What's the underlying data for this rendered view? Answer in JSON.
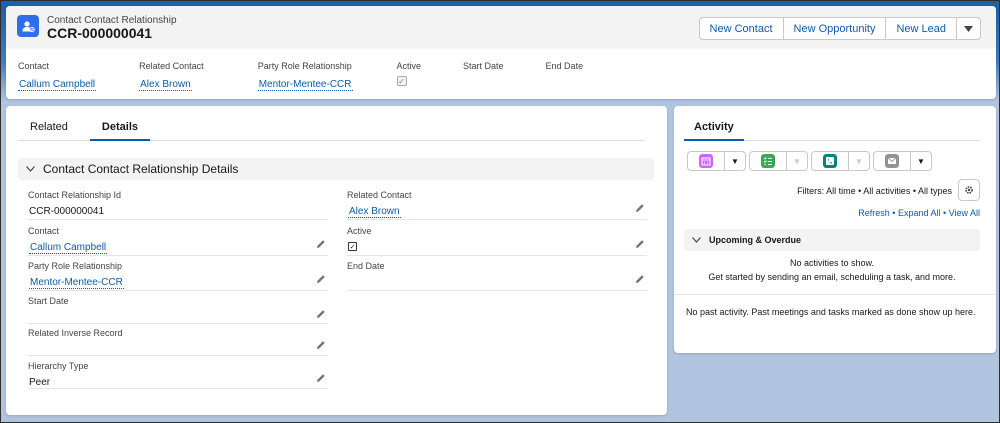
{
  "header": {
    "object_type": "Contact Contact Relationship",
    "record_name": "CCR-000000041",
    "buttons": [
      "New Contact",
      "New Opportunity",
      "New Lead"
    ],
    "highlights": [
      {
        "label": "Contact",
        "value": "Callum Campbell",
        "kind": "link"
      },
      {
        "label": "Related Contact",
        "value": "Alex Brown",
        "kind": "link"
      },
      {
        "label": "Party Role Relationship",
        "value": "Mentor-Mentee-CCR",
        "kind": "link"
      },
      {
        "label": "Active",
        "value": "checked",
        "kind": "checkbox"
      },
      {
        "label": "Start Date",
        "value": "",
        "kind": "text"
      },
      {
        "label": "End Date",
        "value": "",
        "kind": "text"
      }
    ]
  },
  "main": {
    "tabs": [
      "Related",
      "Details"
    ],
    "active_tab": "Details",
    "section_title": "Contact Contact Relationship Details",
    "left_fields": [
      {
        "label": "Contact Relationship Id",
        "value": "CCR-000000041",
        "kind": "text",
        "editable": false
      },
      {
        "label": "Contact",
        "value": "Callum Campbell",
        "kind": "link",
        "editable": true
      },
      {
        "label": "Party Role Relationship",
        "value": "Mentor-Mentee-CCR",
        "kind": "link",
        "editable": true
      },
      {
        "label": "Start Date",
        "value": "",
        "kind": "text",
        "editable": true
      },
      {
        "label": "Related Inverse Record",
        "value": "",
        "kind": "text",
        "editable": true
      },
      {
        "label": "Hierarchy Type",
        "value": "Peer",
        "kind": "text",
        "editable": true
      }
    ],
    "right_fields": [
      {
        "label": "Related Contact",
        "value": "Alex Brown",
        "kind": "link",
        "editable": true
      },
      {
        "label": "Active",
        "value": "checked",
        "kind": "checkbox",
        "editable": true
      },
      {
        "label": "End Date",
        "value": "",
        "kind": "text",
        "editable": true
      }
    ]
  },
  "activity": {
    "tab": "Activity",
    "action_buttons": [
      {
        "icon": "calendar-icon",
        "color": "#cb65ff",
        "dropdown_enabled": true
      },
      {
        "icon": "task-icon",
        "color": "#3ba755",
        "dropdown_enabled": false
      },
      {
        "icon": "phone-icon",
        "color": "#0b827c",
        "dropdown_enabled": false
      },
      {
        "icon": "email-icon",
        "color": "#939393",
        "dropdown_enabled": true
      }
    ],
    "filters": "Filters: All time • All activities • All types",
    "links": [
      "Refresh",
      "Expand All",
      "View All"
    ],
    "upcoming_title": "Upcoming & Overdue",
    "no_activities": "No activities to show.",
    "get_started": "Get started by sending an email, scheduling a task, and more.",
    "past_note": "No past activity. Past meetings and tasks marked as done show up here."
  },
  "colors": {
    "link": "#0b5cab",
    "brand_icon": "#2f6ee8"
  }
}
